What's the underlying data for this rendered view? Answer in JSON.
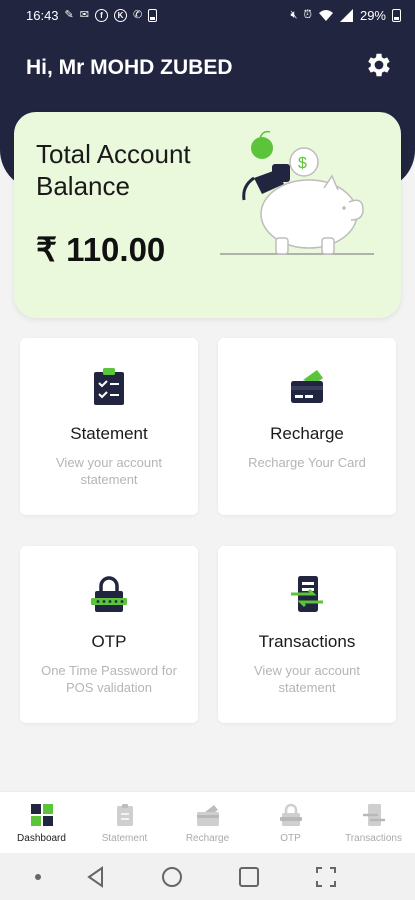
{
  "status_bar": {
    "time": "16:43",
    "battery": "29%",
    "icons": [
      "pencil-icon",
      "mail-icon",
      "fb-icon",
      "k-icon",
      "phone-icon",
      "battery-saver-icon",
      "mute-icon",
      "alarm-icon",
      "wifi-icon",
      "signal-icon"
    ]
  },
  "header": {
    "greeting": "Hi, Mr MOHD ZUBED",
    "settings_icon": "gear-icon",
    "background_color": "#22253f"
  },
  "balance": {
    "title": "Total Account Balance",
    "amount": "₹ 110.00",
    "card_color": "#eaf8dc",
    "accent": "#5bc43a"
  },
  "tiles": [
    {
      "title": "Statement",
      "description": "View your account statement",
      "icon": "clipboard-icon"
    },
    {
      "title": "Recharge",
      "description": "Recharge Your Card",
      "icon": "card-icon"
    },
    {
      "title": "OTP",
      "description": "One Time Password for POS validation",
      "icon": "lock-icon"
    },
    {
      "title": "Transactions",
      "description": "View your account statement",
      "icon": "transfer-icon"
    }
  ],
  "bottom_nav": {
    "items": [
      {
        "label": "Dashboard",
        "icon": "dashboard-icon",
        "active": true
      },
      {
        "label": "Statement",
        "icon": "clipboard-icon",
        "active": false
      },
      {
        "label": "Recharge",
        "icon": "card-icon",
        "active": false
      },
      {
        "label": "OTP",
        "icon": "lock-icon",
        "active": false
      },
      {
        "label": "Transactions",
        "icon": "transfer-icon",
        "active": false
      }
    ]
  },
  "system_nav": {
    "icons": [
      "dot-icon",
      "back-icon",
      "home-icon",
      "recents-icon",
      "screenshot-icon"
    ]
  }
}
